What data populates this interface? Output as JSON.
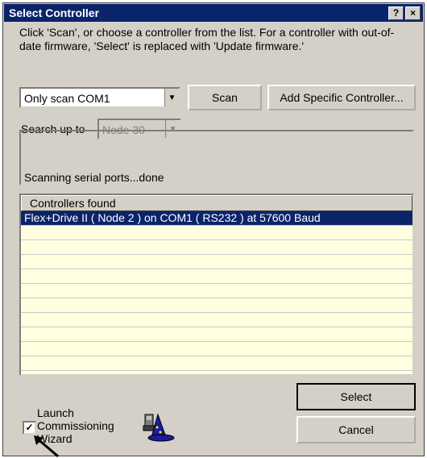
{
  "window": {
    "title": "Select Controller",
    "help_button": "?",
    "close_button": "×"
  },
  "instructions": "Click 'Scan', or choose a controller from the list.  For a controller with out-of-date firmware, 'Select' is replaced with 'Update firmware.'",
  "scan_combo": {
    "value": "Only scan COM1"
  },
  "buttons": {
    "scan": "Scan",
    "add_specific": "Add Specific Controller...",
    "select": "Select",
    "cancel": "Cancel"
  },
  "search": {
    "label": "Search up to",
    "value": "Node  30"
  },
  "status": "Scanning serial ports...done",
  "list": {
    "header": "Controllers found",
    "rows": [
      "Flex+Drive II ( Node 2 ) on COM1 ( RS232 ) at 57600 Baud"
    ]
  },
  "launch_wizard": {
    "checked": true,
    "check_glyph": "✓",
    "label": "Launch Commissioning Wizard"
  },
  "icons": [
    "wizard-icon",
    "mouse-pointer-icon",
    "dropdown-arrow-icon"
  ]
}
